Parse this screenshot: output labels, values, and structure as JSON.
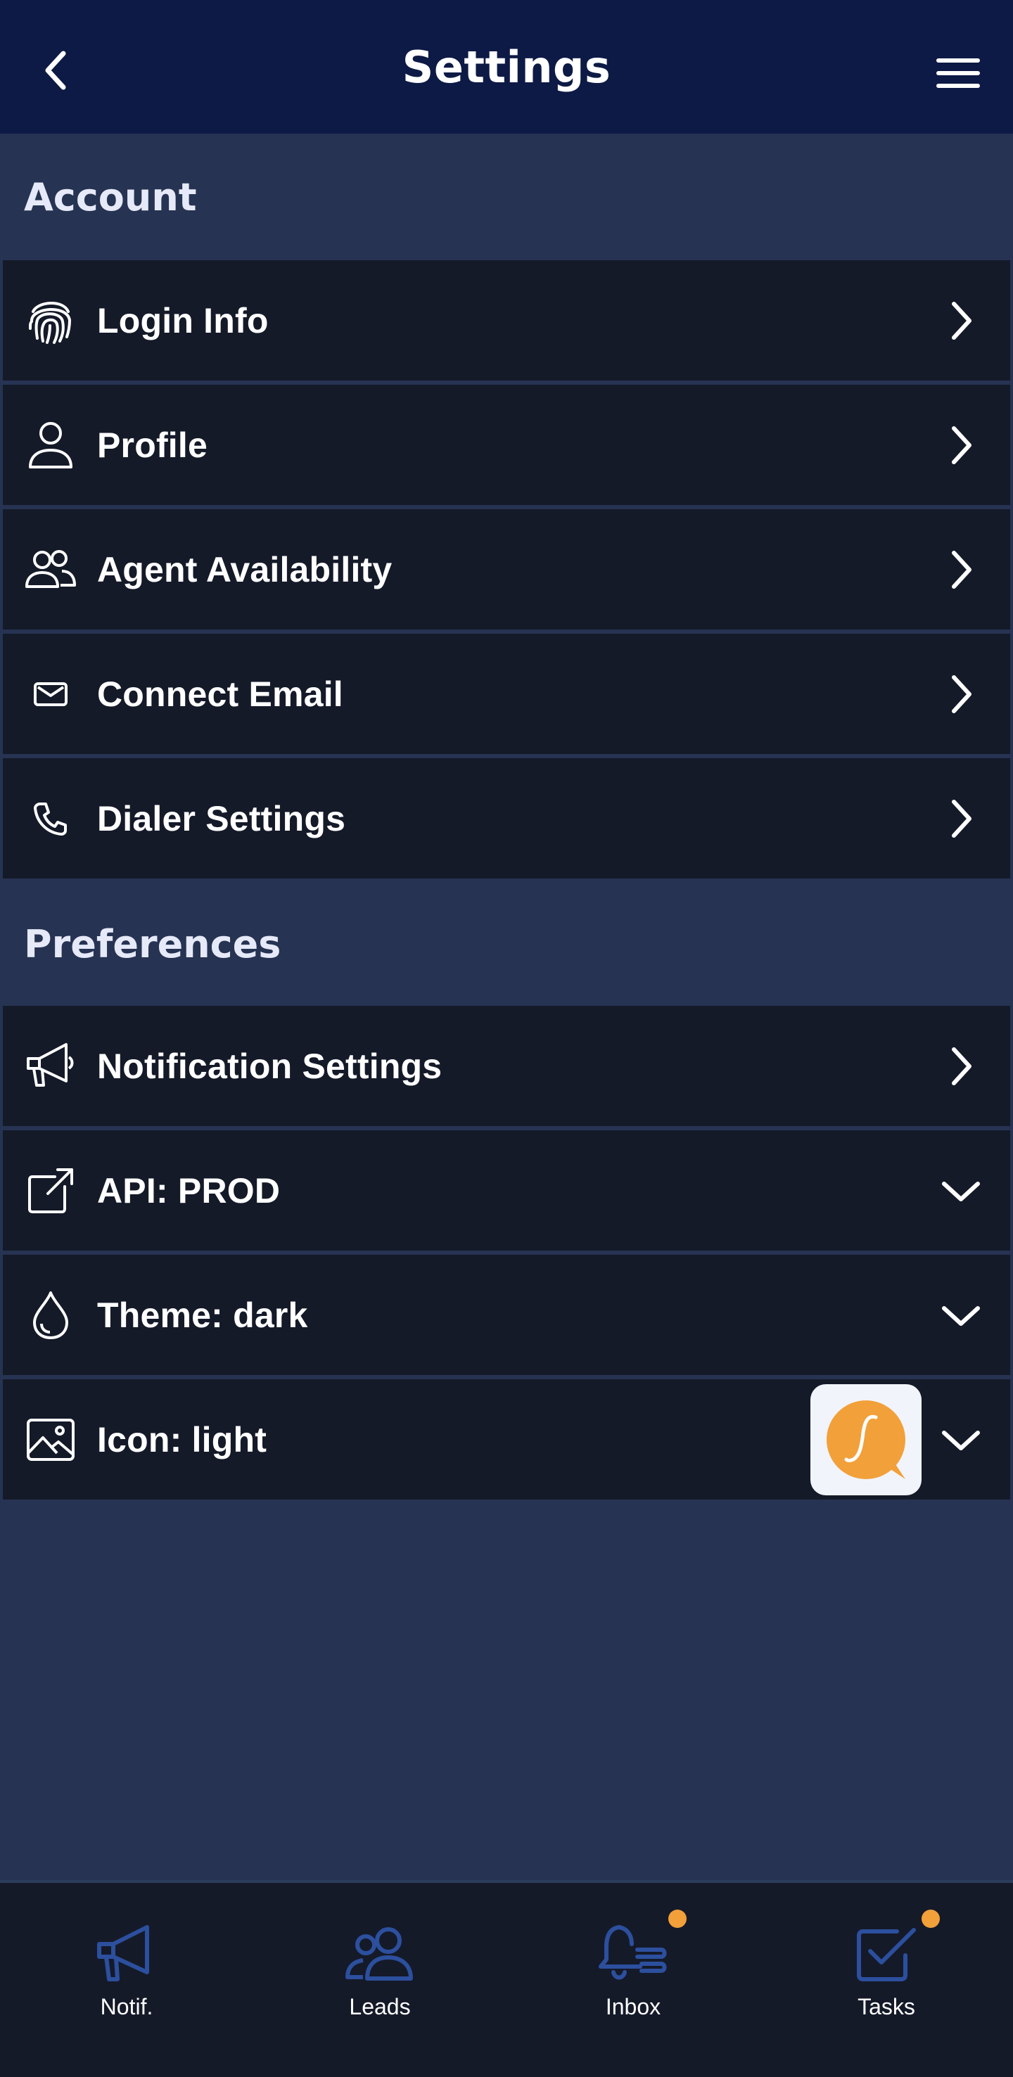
{
  "header": {
    "title": "Settings",
    "back_icon": "chevron-left-icon",
    "menu_icon": "hamburger-menu-icon"
  },
  "sections": {
    "account": {
      "title": "Account",
      "items": [
        {
          "label": "Login Info",
          "icon": "fingerprint-icon",
          "action": "chevron-right-icon"
        },
        {
          "label": "Profile",
          "icon": "user-icon",
          "action": "chevron-right-icon"
        },
        {
          "label": "Agent Availability",
          "icon": "users-icon",
          "action": "chevron-right-icon"
        },
        {
          "label": "Connect Email",
          "icon": "envelope-icon",
          "action": "chevron-right-icon"
        },
        {
          "label": "Dialer Settings",
          "icon": "phone-icon",
          "action": "chevron-right-icon"
        }
      ]
    },
    "preferences": {
      "title": "Preferences",
      "items": [
        {
          "label": "Notification Settings",
          "icon": "megaphone-icon",
          "action": "chevron-right-icon"
        },
        {
          "label": "API: PROD",
          "icon": "external-link-icon",
          "action": "chevron-down-icon"
        },
        {
          "label": "Theme: dark",
          "icon": "droplet-icon",
          "action": "chevron-down-icon"
        },
        {
          "label": "Icon: light",
          "icon": "image-icon",
          "action": "chevron-down-icon",
          "preview": "app-logo-icon"
        }
      ]
    }
  },
  "bottom_nav": {
    "items": [
      {
        "label": "Notif.",
        "icon": "megaphone-icon",
        "badge": false
      },
      {
        "label": "Leads",
        "icon": "users-icon",
        "badge": false
      },
      {
        "label": "Inbox",
        "icon": "bell-inbox-icon",
        "badge": true
      },
      {
        "label": "Tasks",
        "icon": "checkbox-icon",
        "badge": true
      }
    ]
  },
  "colors": {
    "header_bg": "#0d1a45",
    "page_bg": "#263352",
    "row_bg": "#151a29",
    "nav_icon": "#2c4f9e",
    "badge": "#f2a03a",
    "app_icon_orange": "#f2a03a"
  }
}
